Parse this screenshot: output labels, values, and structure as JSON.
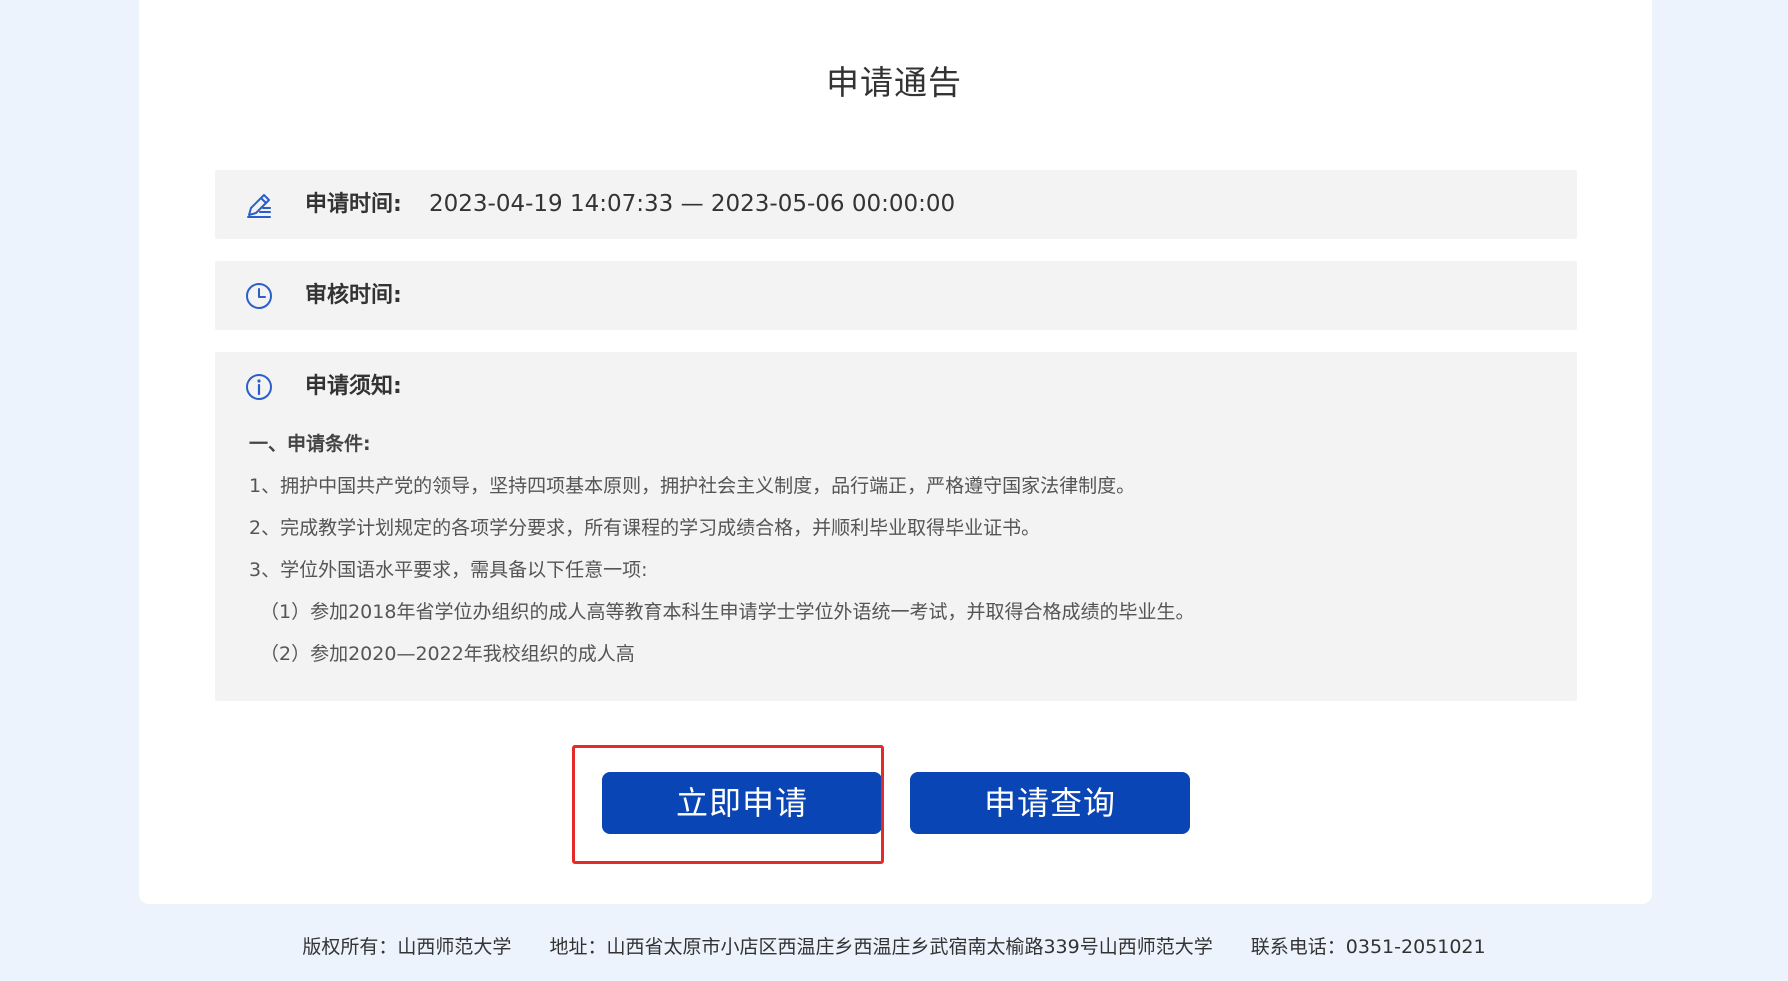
{
  "page": {
    "title": "申请通告"
  },
  "apply_time": {
    "icon": "pen-edit-icon",
    "label": "申请时间:",
    "value": "2023-04-19 14:07:33 — 2023-05-06 00:00:00"
  },
  "review_time": {
    "icon": "clock-icon",
    "label": "审核时间:",
    "value": ""
  },
  "notice": {
    "icon": "info-circle-icon",
    "label": "申请须知:",
    "lines": [
      "一、申请条件:",
      "1、拥护中国共产党的领导，坚持四项基本原则，拥护社会主义制度，品行端正，严格遵守国家法律制度。",
      "2、完成教学计划规定的各项学分要求，所有课程的学习成绩合格，并顺利毕业取得毕业证书。",
      "3、学位外国语水平要求，需具备以下任意一项:",
      "（1）参加2018年省学位办组织的成人高等教育本科生申请学士学位外语统一考试，并取得合格成绩的毕业生。",
      "（2）参加2020—2022年我校组织的成人高"
    ]
  },
  "buttons": {
    "apply": "立即申请",
    "query": "申请查询"
  },
  "footer": {
    "copyright": "版权所有：山西师范大学",
    "address": "地址：山西省太原市小店区西温庄乡西温庄乡武宿南太榆路339号山西师范大学",
    "phone": "联系电话：0351-2051021"
  },
  "colors": {
    "page_background": "#ecf3fd",
    "card_background": "#ffffff",
    "panel_background": "#f3f3f3",
    "primary_button": "#0a45b5",
    "icon_blue": "#2a5fc9",
    "highlight_red": "#e52a2a"
  }
}
